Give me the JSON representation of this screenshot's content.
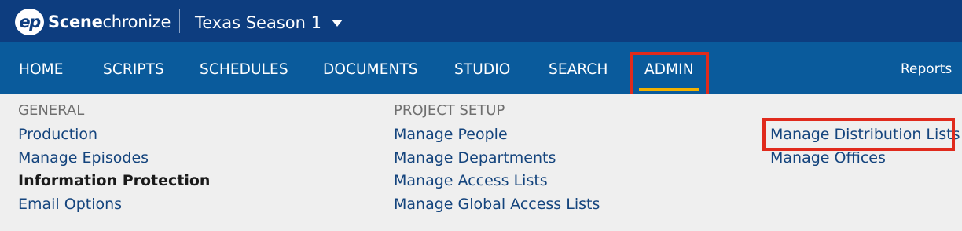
{
  "brand": {
    "mark": "ep",
    "name_bold": "Scene",
    "name_rest": "chronize"
  },
  "project": {
    "title": "Texas Season 1"
  },
  "nav": {
    "items": [
      "HOME",
      "SCRIPTS",
      "SCHEDULES",
      "DOCUMENTS",
      "STUDIO",
      "SEARCH",
      "ADMIN"
    ],
    "active": "ADMIN",
    "reports": "Reports"
  },
  "admin_menu": {
    "general": {
      "heading": "GENERAL",
      "links": [
        "Production",
        "Manage Episodes",
        "Information Protection",
        "Email Options"
      ],
      "selected": "Information Protection"
    },
    "project_setup": {
      "heading": "PROJECT SETUP",
      "links": [
        "Manage People",
        "Manage Departments",
        "Manage Access Lists",
        "Manage Global Access Lists"
      ]
    },
    "other": {
      "links": [
        "Manage Distribution Lists",
        "Manage Offices"
      ]
    }
  },
  "colors": {
    "topbar": "#0d3d7f",
    "navbar": "#0a5b9c",
    "active_underline": "#f2b100",
    "highlight_box": "#e02a1c",
    "link": "#14447d"
  }
}
